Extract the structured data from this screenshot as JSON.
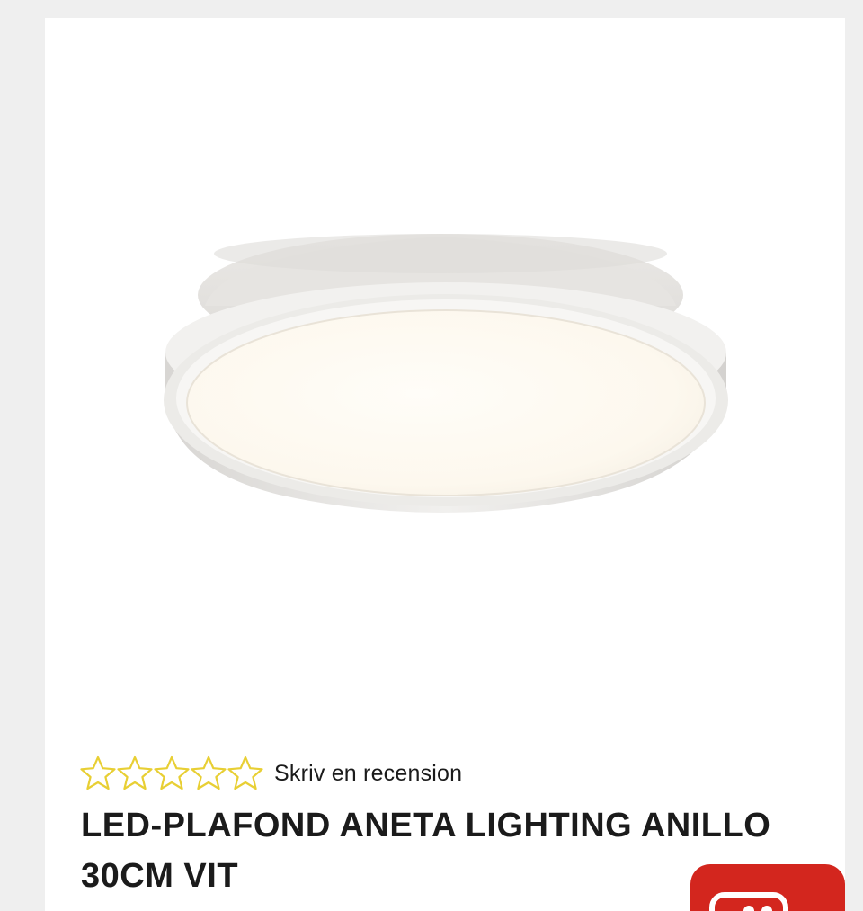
{
  "product": {
    "image_alt": "LED-PLAFOND ANETA LIGHTING ANILLO 30CM VIT",
    "rating": {
      "value": 0,
      "max": 5,
      "star_color": "#e8cf34",
      "review_link": "Skriv en recension"
    },
    "title": "LED-PLAFOND ANETA LIGHTING ANILLO 30CM VIT"
  },
  "chat": {
    "icon": "chat-icon",
    "color": "#d3261e"
  }
}
